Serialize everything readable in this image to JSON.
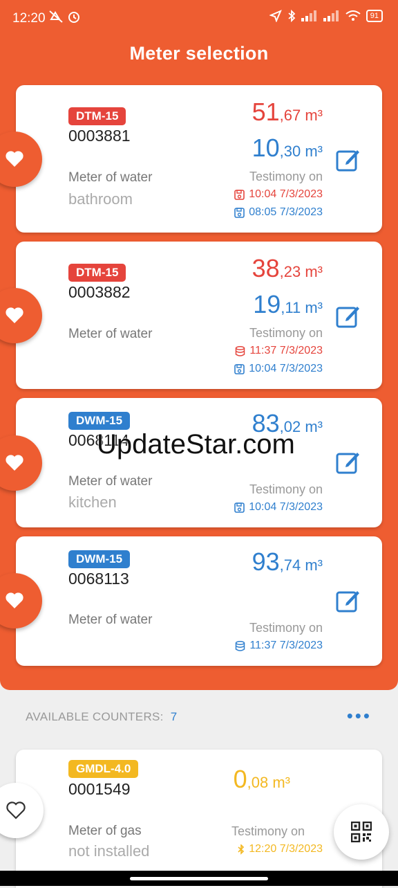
{
  "status_bar": {
    "time": "12:20",
    "battery": "91"
  },
  "header": {
    "title": "Meter selection"
  },
  "meters": [
    {
      "badge": "DTM-15",
      "serial": "0003881",
      "kind": "Meter of water",
      "place": "bathroom",
      "value1_int": "51",
      "value1_dec": ",67 m³",
      "value2_int": "10",
      "value2_dec": ",30 m³",
      "testimony": "Testimony on",
      "ts1": "10:04 7/3/2023",
      "ts2": "08:05 7/3/2023"
    },
    {
      "badge": "DTM-15",
      "serial": "0003882",
      "kind": "Meter of water",
      "place": "",
      "value1_int": "38",
      "value1_dec": ",23 m³",
      "value2_int": "19",
      "value2_dec": ",11 m³",
      "testimony": "Testimony on",
      "ts1": "11:37 7/3/2023",
      "ts2": "10:04 7/3/2023"
    },
    {
      "badge": "DWM-15",
      "serial": "0068114",
      "kind": "Meter of water",
      "place": "kitchen",
      "value1_int": "83",
      "value1_dec": ",02 m³",
      "testimony": "Testimony on",
      "ts1": "10:04 7/3/2023"
    },
    {
      "badge": "DWM-15",
      "serial": "0068113",
      "kind": "Meter of water",
      "place": "",
      "value1_int": "93",
      "value1_dec": ",74 m³",
      "testimony": "Testimony on",
      "ts1": "11:37 7/3/2023"
    }
  ],
  "available": {
    "label": "AVAILABLE COUNTERS:",
    "count": "7",
    "more": "•••"
  },
  "gas_meter": {
    "badge": "GMDL-4.0",
    "serial": "0001549",
    "kind": "Meter of gas",
    "place": "not installed",
    "value_int": "0",
    "value_dec": ",08 m³",
    "testimony": "Testimony on",
    "ts": "12:20 7/3/2023"
  },
  "watermark": "UpdateStar.com",
  "colors": {
    "accent": "#ee5d31",
    "red": "#e5443c",
    "blue": "#2f7fce",
    "yellow": "#f3b821"
  },
  "icons": [
    "heart-icon",
    "edit-icon",
    "floppy-icon",
    "database-icon",
    "bluetooth-icon",
    "qr-code-icon"
  ]
}
